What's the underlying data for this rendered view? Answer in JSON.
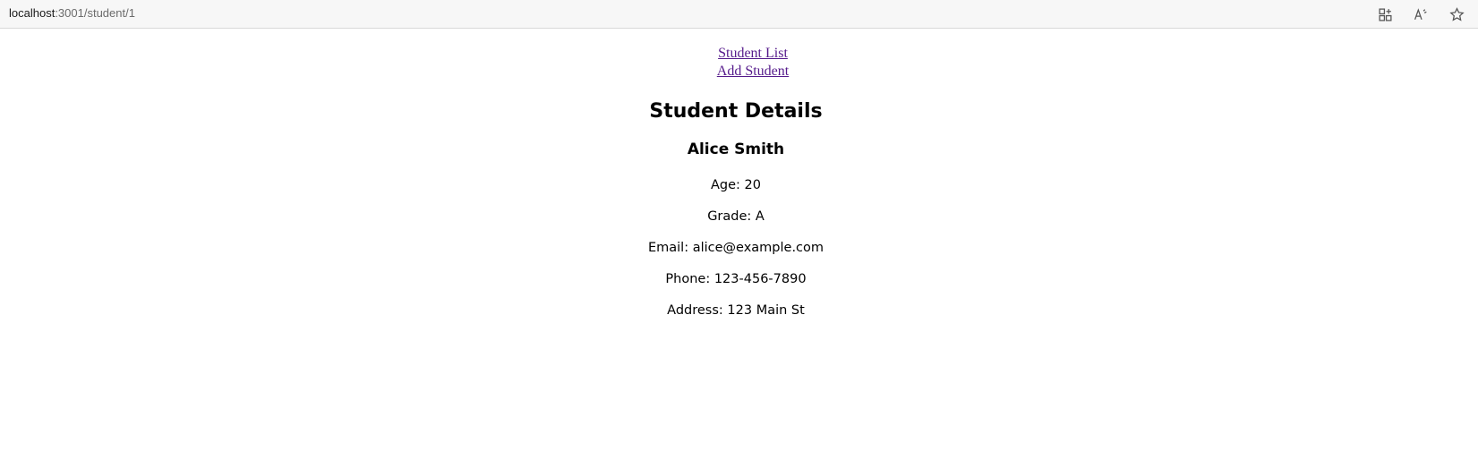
{
  "browser": {
    "url_host": "localhost",
    "url_path": ":3001/student/1",
    "icons": [
      "app-available-icon",
      "read-aloud-icon",
      "favorite-star-icon"
    ]
  },
  "nav": {
    "student_list": "Student List",
    "add_student": "Add Student"
  },
  "details": {
    "heading": "Student Details",
    "name": "Alice Smith",
    "age": "Age: 20",
    "grade": "Grade: A",
    "email": "Email: alice@example.com",
    "phone": "Phone: 123-456-7890",
    "address": "Address: 123 Main St"
  },
  "colors": {
    "visited_link": "#551a8b",
    "toolbar_bg": "#f7f7f7"
  }
}
